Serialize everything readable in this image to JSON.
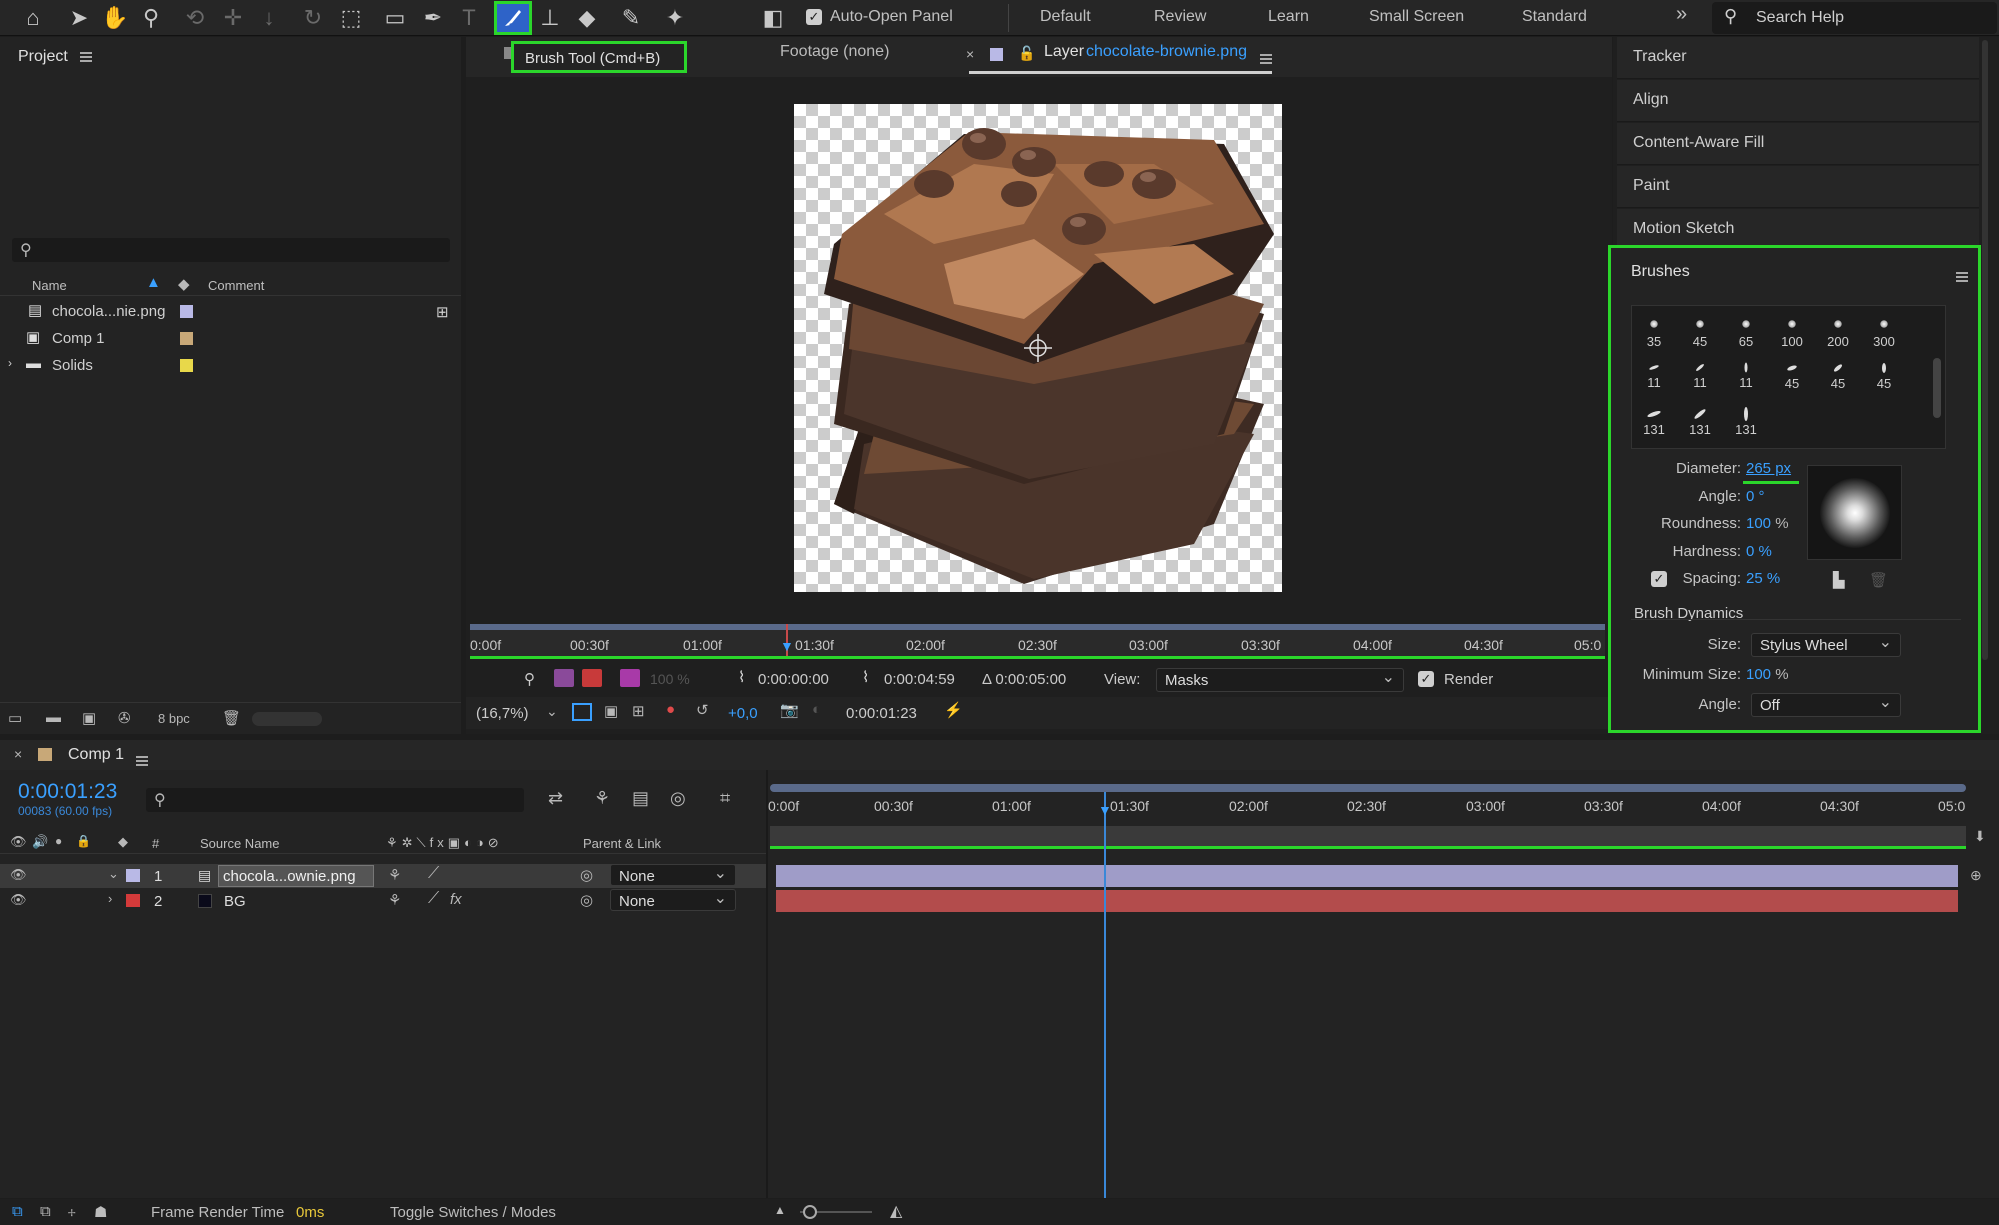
{
  "toolbar": {
    "auto_open_label": "Auto-Open Panel",
    "workspaces": [
      "Default",
      "Review",
      "Learn",
      "Small Screen",
      "Standard"
    ],
    "more": "»",
    "search_placeholder": "Search Help"
  },
  "project": {
    "title": "Project",
    "columns": {
      "name": "Name",
      "comment": "Comment"
    },
    "items": [
      {
        "name": "chocola...nie.png",
        "color": "#b9b9e6"
      },
      {
        "name": "Comp 1",
        "color": "#c8a878"
      },
      {
        "name": "Solids",
        "color": "#e8d84a"
      }
    ],
    "bpc": "8 bpc"
  },
  "viewer": {
    "tooltip": "Brush Tool (Cmd+B)",
    "footage_tab": "Footage (none)",
    "layer_tab_prefix": "Layer",
    "layer_tab_name": "chocolate-brownie.png",
    "ruler_labels": [
      "0:00f",
      "00:30f",
      "01:00f",
      "01:30f",
      "02:00f",
      "02:30f",
      "03:00f",
      "03:30f",
      "04:00f",
      "04:30f",
      "05:0"
    ],
    "opacity": "100 %",
    "in_time": "0:00:00:00",
    "out_time": "0:00:04:59",
    "duration": "Δ 0:00:05:00",
    "view_label": "View:",
    "view_value": "Masks",
    "render_label": "Render",
    "zoom": "(16,7%)",
    "exposure": "+0,0",
    "current_time": "0:00:01:23"
  },
  "right_panels": {
    "items": [
      "Tracker",
      "Align",
      "Content-Aware Fill",
      "Paint",
      "Motion Sketch"
    ],
    "brushes_title": "Brushes",
    "brush_sizes": [
      "35",
      "45",
      "65",
      "100",
      "200",
      "300",
      "11",
      "11",
      "11",
      "45",
      "45",
      "45",
      "131",
      "131",
      "131"
    ],
    "diameter_label": "Diameter:",
    "diameter_value": "265 px",
    "angle_label": "Angle:",
    "angle_value": "0 °",
    "roundness_label": "Roundness:",
    "roundness_value": "100",
    "roundness_unit": "%",
    "hardness_label": "Hardness:",
    "hardness_value": "0 %",
    "spacing_label": "Spacing:",
    "spacing_value": "25 %",
    "dynamics_title": "Brush Dynamics",
    "size_label": "Size:",
    "size_value": "Stylus Wheel",
    "min_size_label": "Minimum Size:",
    "min_size_value": "100",
    "min_size_unit": "%",
    "dyn_angle_label": "Angle:",
    "dyn_angle_value": "Off"
  },
  "timeline": {
    "tab_title": "Comp 1",
    "current_time": "0:00:01:23",
    "frame_info": "00083 (60.00 fps)",
    "columns": {
      "hash": "#",
      "source": "Source Name",
      "parent": "Parent & Link"
    },
    "ruler_labels": [
      "0:00f",
      "00:30f",
      "01:00f",
      "01:30f",
      "02:00f",
      "02:30f",
      "03:00f",
      "03:30f",
      "04:00f",
      "04:30f",
      "05:0"
    ],
    "layers": [
      {
        "num": "1",
        "name": "chocola...ownie.png",
        "label_color": "#b9b9e6",
        "parent": "None",
        "bar_color": "#9f9cc8"
      },
      {
        "num": "2",
        "name": "BG",
        "label_color": "#d43a3a",
        "parent": "None",
        "bar_color": "#b34c4c"
      }
    ]
  },
  "status": {
    "frame_render_label": "Frame Render Time",
    "frame_render_value": "0ms",
    "toggle_label": "Toggle Switches / Modes"
  }
}
